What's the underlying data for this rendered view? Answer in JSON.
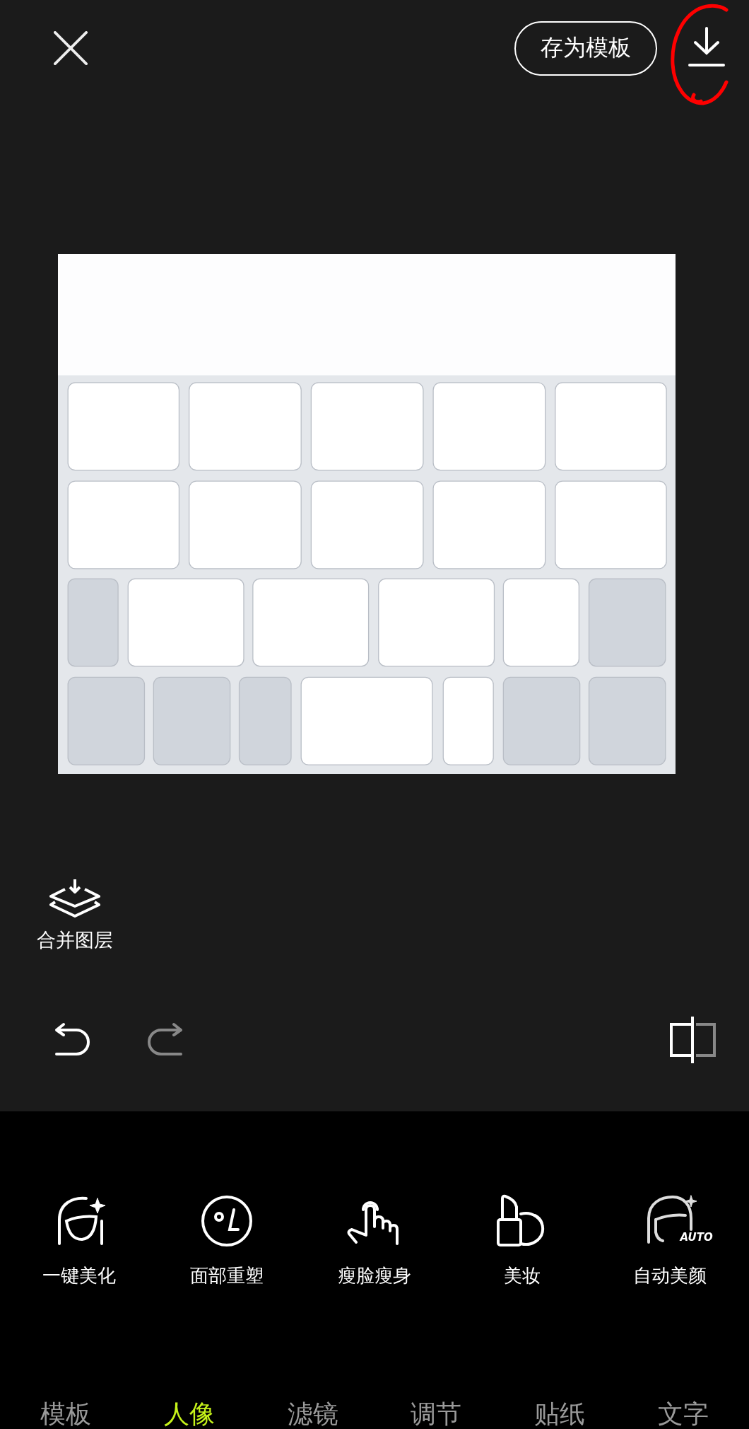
{
  "top_bar": {
    "save_template_button": "存为模板"
  },
  "merge_layers_button": "合并图层",
  "history": {
    "undo_disabled": false,
    "redo_disabled": true
  },
  "tools": [
    {
      "kind": "beauty",
      "label": "一键美化"
    },
    {
      "kind": "face",
      "label": "面部重塑"
    },
    {
      "kind": "slim",
      "label": "瘦脸瘦身"
    },
    {
      "kind": "makeup",
      "label": "美妆"
    },
    {
      "kind": "auto",
      "label": "自动美颜",
      "badge": "AUTO"
    }
  ],
  "tabs": [
    {
      "label": "模板",
      "selected": false
    },
    {
      "label": "人像",
      "selected": true
    },
    {
      "label": "滤镜",
      "selected": false
    },
    {
      "label": "调节",
      "selected": false
    },
    {
      "label": "贴纸",
      "selected": false
    },
    {
      "label": "文字",
      "selected": false
    }
  ]
}
